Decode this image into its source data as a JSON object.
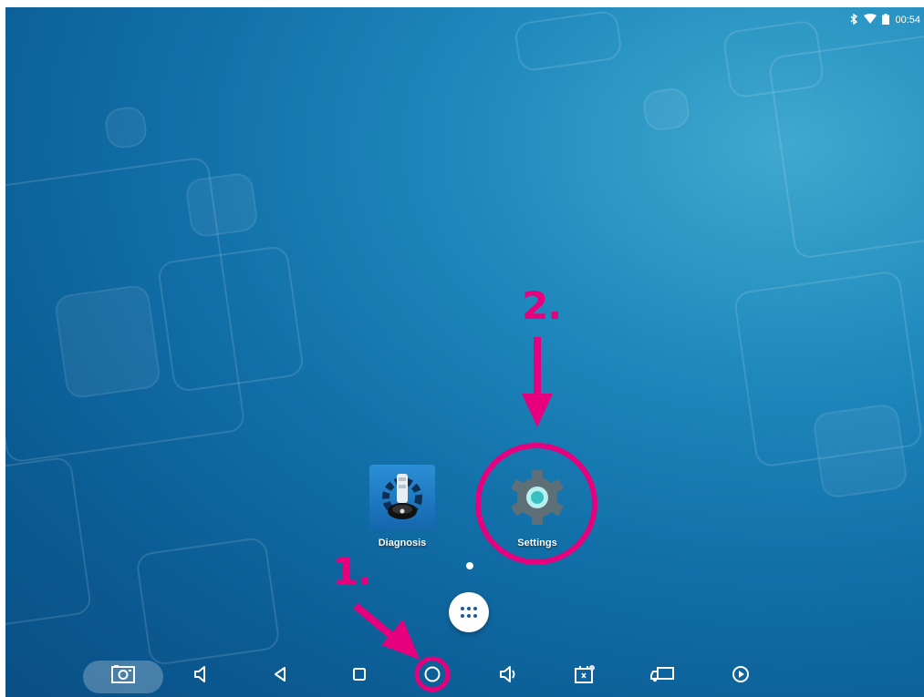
{
  "status": {
    "time": "00:54",
    "icons": [
      "bluetooth-icon",
      "wifi-icon",
      "battery-icon"
    ]
  },
  "home": {
    "apps": [
      {
        "name": "diagnosis",
        "label": "Diagnosis",
        "icon": "diagnosis-app-icon"
      },
      {
        "name": "settings",
        "label": "Settings",
        "icon": "gear-icon"
      }
    ],
    "all_apps_icon": "app-drawer-icon"
  },
  "nav": [
    "screenshot-icon",
    "volume-down-icon",
    "back-icon",
    "recents-icon",
    "home-icon",
    "volume-up-icon",
    "vci-icon",
    "truck-icon",
    "play-icon"
  ],
  "annotations": {
    "step1": "1.",
    "step2": "2."
  },
  "colors": {
    "annotation": "#e6007e",
    "wallpaper": "#0b5b93"
  }
}
